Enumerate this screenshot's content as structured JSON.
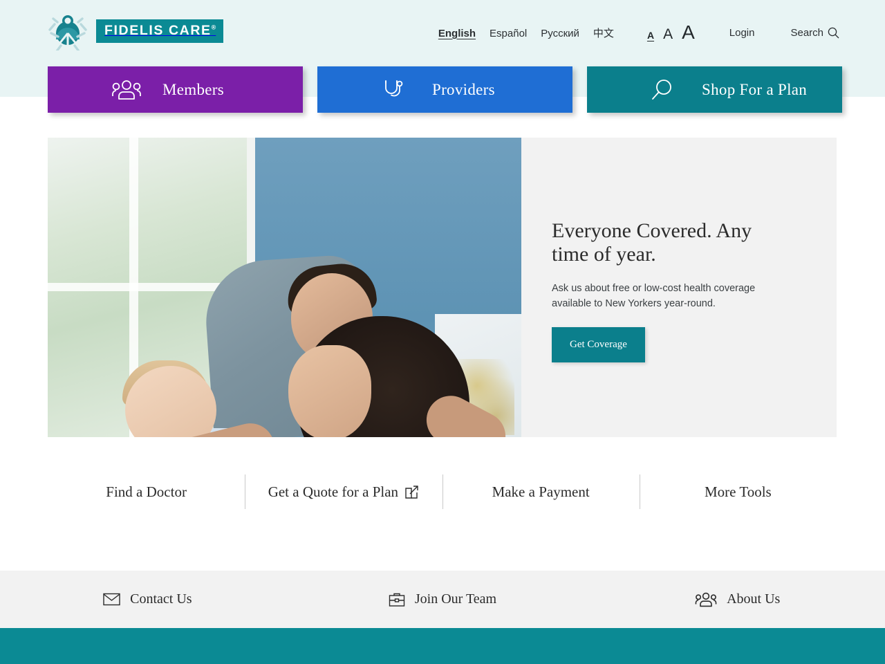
{
  "brand": {
    "name": "FIDELIS CARE",
    "trademark": "®",
    "logo_icon": "fidelis-family-logo-icon",
    "teal": "#0b8a94"
  },
  "header": {
    "languages": [
      {
        "label": "English",
        "active": true
      },
      {
        "label": "Español",
        "active": false
      },
      {
        "label": "Русский",
        "active": false
      },
      {
        "label": "中文",
        "active": false
      }
    ],
    "text_size": {
      "small": "A",
      "medium": "A",
      "large": "A",
      "active": "small"
    },
    "login_label": "Login",
    "search_label": "Search",
    "search_icon": "search-icon"
  },
  "nav_buttons": [
    {
      "label": "Members",
      "icon": "people-group-icon",
      "color": "#7b1fa8"
    },
    {
      "label": "Providers",
      "icon": "stethoscope-icon",
      "color": "#1f6ed4"
    },
    {
      "label": "Shop For a Plan",
      "icon": "magnifier-icon",
      "color": "#0b7f8c"
    }
  ],
  "hero": {
    "image_alt": "Father, mother and baby smiling together near a window",
    "heading": "Everyone Covered. Any time of year.",
    "body": "Ask us about free or low-cost health coverage available to New Yorkers year-round.",
    "cta_label": "Get Coverage",
    "cta_color": "#0b7f8c"
  },
  "quick_links": [
    {
      "label": "Find a Doctor",
      "external": false
    },
    {
      "label": "Get a Quote for a Plan",
      "external": true
    },
    {
      "label": "Make a Payment",
      "external": false
    },
    {
      "label": "More Tools",
      "external": false
    }
  ],
  "footer_links": [
    {
      "label": "Contact Us",
      "icon": "envelope-icon"
    },
    {
      "label": "Join Our Team",
      "icon": "briefcase-icon"
    },
    {
      "label": "About Us",
      "icon": "people-group-icon"
    }
  ]
}
